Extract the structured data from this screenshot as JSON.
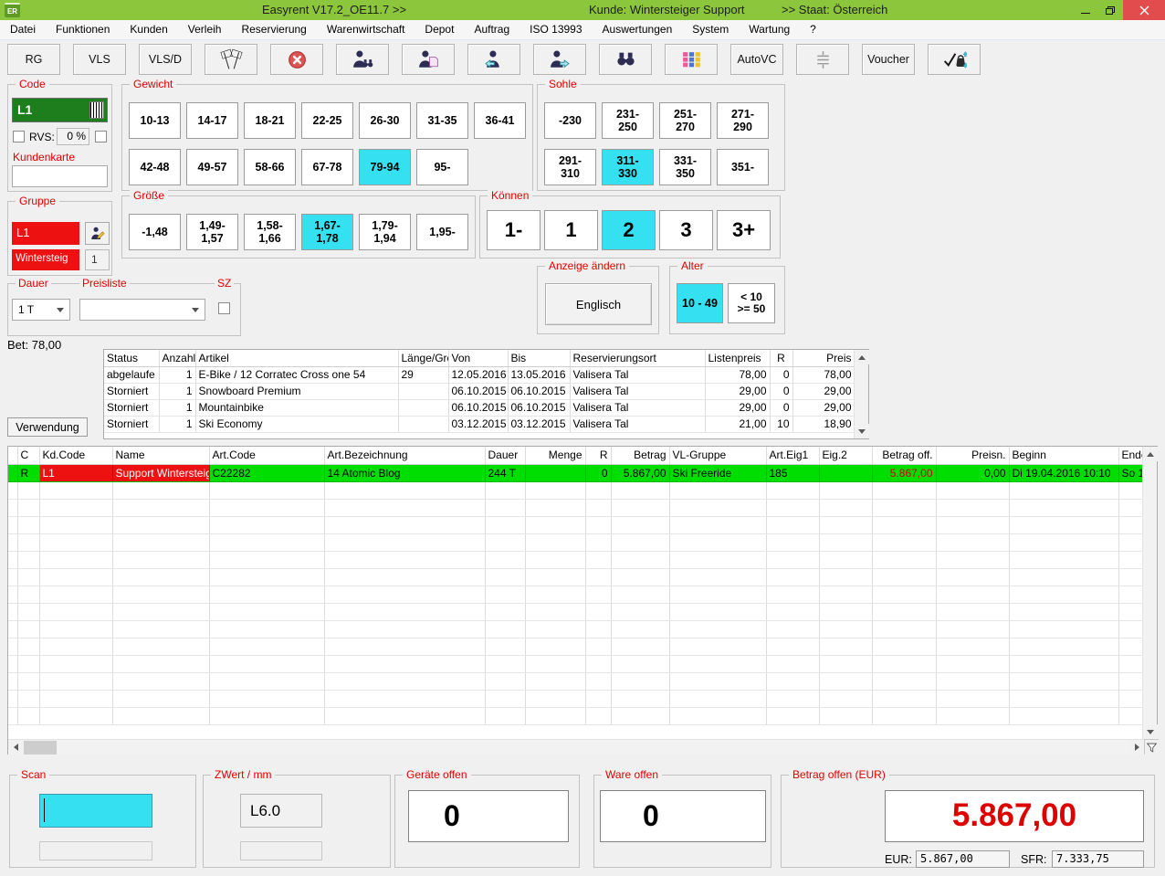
{
  "titlebar": {
    "logo": "ER",
    "title": "Easyrent V17.2_OE11.7 >>",
    "customer": "Kunde: Wintersteiger Support",
    "staat": ">> Staat: Österreich"
  },
  "menu": {
    "items": [
      "Datei",
      "Funktionen",
      "Kunden",
      "Verleih",
      "Reservierung",
      "Warenwirtschaft",
      "Depot",
      "Auftrag",
      "ISO 13993",
      "Auswertungen",
      "System",
      "Wartung",
      "?"
    ]
  },
  "toolbar": {
    "rg": "RG",
    "vls": "VLS",
    "vlsd": "VLS/D",
    "autovc": "AutoVC",
    "voucher": "Voucher"
  },
  "panel": {
    "code": {
      "label": "Code",
      "value": "L1"
    },
    "rvs": {
      "label": "RVS:",
      "value": "0 %"
    },
    "kundenkarte": {
      "label": "Kundenkarte",
      "value": ""
    },
    "gruppe": {
      "label": "Gruppe",
      "code": "L1",
      "name": "Wintersteig",
      "qty": "1"
    },
    "dauer": {
      "label": "Dauer",
      "value": "1 T"
    },
    "preisliste": {
      "label": "Preisliste",
      "value": ""
    },
    "sz": {
      "label": "SZ"
    },
    "bet_text": "Bet: 78,00",
    "verwendung": "Verwendung"
  },
  "filters": {
    "gewicht": {
      "label": "Gewicht",
      "options": [
        {
          "label": "10-13",
          "selected": false
        },
        {
          "label": "14-17",
          "selected": false
        },
        {
          "label": "18-21",
          "selected": false
        },
        {
          "label": "22-25",
          "selected": false
        },
        {
          "label": "26-30",
          "selected": false
        },
        {
          "label": "31-35",
          "selected": false
        },
        {
          "label": "36-41",
          "selected": false
        },
        {
          "label": "42-48",
          "selected": false
        },
        {
          "label": "49-57",
          "selected": false
        },
        {
          "label": "58-66",
          "selected": false
        },
        {
          "label": "67-78",
          "selected": false
        },
        {
          "label": "79-94",
          "selected": true
        },
        {
          "label": "95-",
          "selected": false
        }
      ]
    },
    "sohle": {
      "label": "Sohle",
      "options": [
        {
          "label": "-230",
          "selected": false
        },
        {
          "label": "231-\n250",
          "selected": false
        },
        {
          "label": "251-\n270",
          "selected": false
        },
        {
          "label": "271-\n290",
          "selected": false
        },
        {
          "label": "291-\n310",
          "selected": false
        },
        {
          "label": "311-\n330",
          "selected": true
        },
        {
          "label": "331-\n350",
          "selected": false
        },
        {
          "label": "351-",
          "selected": false
        }
      ]
    },
    "groesse": {
      "label": "Größe",
      "options": [
        {
          "label": "-1,48",
          "selected": false
        },
        {
          "label": "1,49-\n1,57",
          "selected": false
        },
        {
          "label": "1,58-\n1,66",
          "selected": false
        },
        {
          "label": "1,67-\n1,78",
          "selected": true
        },
        {
          "label": "1,79-\n1,94",
          "selected": false
        },
        {
          "label": "1,95-",
          "selected": false
        }
      ]
    },
    "koennen": {
      "label": "Können",
      "options": [
        {
          "label": "1-",
          "selected": false
        },
        {
          "label": "1",
          "selected": false
        },
        {
          "label": "2",
          "selected": true
        },
        {
          "label": "3",
          "selected": false
        },
        {
          "label": "3+",
          "selected": false
        }
      ]
    },
    "anzeige": {
      "label": "Anzeige ändern",
      "button": "Englisch"
    },
    "alter": {
      "label": "Alter",
      "options": [
        {
          "label": "10 - 49",
          "selected": true
        },
        {
          "label": "< 10\n>= 50",
          "selected": false
        }
      ]
    }
  },
  "reservations": {
    "headers": [
      "Status",
      "Anzahl",
      "Artikel",
      "Länge/Größe",
      "Von",
      "Bis",
      "Reservierungsort",
      "Listenpreis",
      "R",
      "Preis"
    ],
    "rows": [
      [
        "abgelaufe",
        "1",
        "E-Bike / 12 Corratec Cross one 54",
        "29",
        "12.05.2016",
        "13.05.2016",
        "Valisera Tal",
        "78,00",
        "0",
        "78,00"
      ],
      [
        "Storniert",
        "1",
        "Snowboard Premium",
        "",
        "06.10.2015",
        "06.10.2015",
        "Valisera Tal",
        "29,00",
        "0",
        "29,00"
      ],
      [
        "Storniert",
        "1",
        "Mountainbike",
        "",
        "06.10.2015",
        "06.10.2015",
        "Valisera Tal",
        "29,00",
        "0",
        "29,00"
      ],
      [
        "Storniert",
        "1",
        "Ski Economy",
        "",
        "03.12.2015",
        "03.12.2015",
        "Valisera Tal",
        "21,00",
        "10",
        "18,90"
      ]
    ]
  },
  "positions": {
    "headers": [
      "C",
      "Kd.Code",
      "Name",
      "Art.Code",
      "Art.Bezeichnung",
      "Dauer",
      "Menge",
      "R",
      "Betrag",
      "VL-Gruppe",
      "Art.Eig1",
      "Eig.2",
      "Betrag off.",
      "Preisn.",
      "Beginn",
      "Ende"
    ],
    "row": [
      "R",
      "L1",
      "Support Wintersteiger",
      "C22282",
      "14 Atomic Blog",
      "244 T",
      "",
      "0",
      "5.867,00",
      "Ski Freeride",
      "185",
      "",
      "5.867,00",
      "0,00",
      "Di 19.04.2016 10:10",
      "So 1"
    ]
  },
  "footer": {
    "scan": {
      "label": "Scan"
    },
    "zwert": {
      "label": "ZWert / mm",
      "value": "L6.0"
    },
    "geraete": {
      "label": "Geräte offen",
      "value": "0"
    },
    "ware": {
      "label": "Ware offen",
      "value": "0"
    },
    "betrag": {
      "label": "Betrag offen (EUR)",
      "value": "5.867,00",
      "eur_label": "EUR:",
      "eur_value": "5.867,00",
      "sfr_label": "SFR:",
      "sfr_value": "7.333,75"
    }
  },
  "colors": {
    "titlebar_green": "#8cc63c",
    "selection_cyan": "#35e1f0",
    "code_field_green": "#1e7e1e",
    "group_field_red": "#ee1111",
    "active_row_green": "#00dd00",
    "label_red": "#e00000",
    "amount_red": "#dd0000",
    "close_button_red": "#e24c4c"
  }
}
